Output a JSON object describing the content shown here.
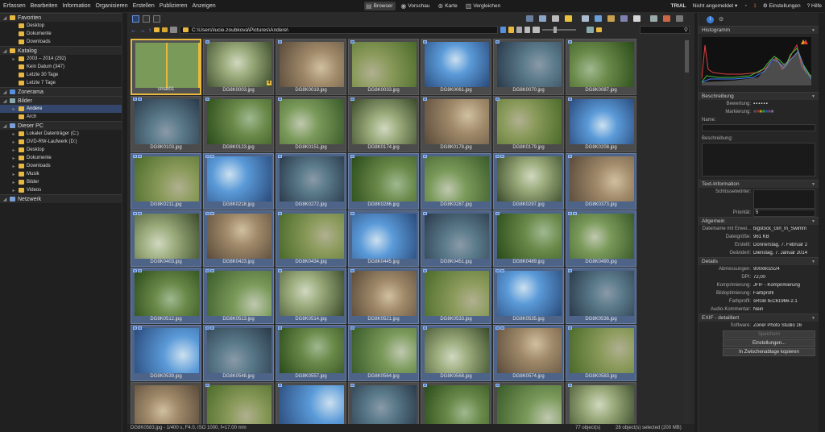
{
  "menu": [
    "Erfassen",
    "Bearbeiten",
    "Information",
    "Organisieren",
    "Erstellen",
    "Publizieren",
    "Anzeigen"
  ],
  "modes": [
    {
      "label": "Browser",
      "icon": "browser-icon"
    },
    {
      "label": "Vorschau",
      "icon": "preview-icon"
    },
    {
      "label": "Karte",
      "icon": "map-icon"
    },
    {
      "label": "Vergleichen",
      "icon": "compare-icon"
    }
  ],
  "rightmenu": {
    "trial": "TRIAL",
    "user": "Nicht angemeldet",
    "notif": "1",
    "settings": "Einstellungen",
    "help": "Hilfe"
  },
  "navigator": {
    "favoriten": {
      "title": "Favoriten",
      "items": [
        "Desktop",
        "Dokumente",
        "Downloads"
      ]
    },
    "katalog": {
      "title": "Katalog",
      "items": [
        "2003 – 2014 (292)",
        "Kein Datum (347)",
        "Letzte 30 Tage",
        "Letzte 7 Tage"
      ]
    },
    "zonerama": "Zonerama",
    "bilder": {
      "title": "Bilder",
      "items": [
        "Andere",
        "Arch"
      ]
    },
    "pc": {
      "title": "Dieser PC",
      "items": [
        "Lokaler Datenträger (C:)",
        "DVD-RW-Laufwerk (D:)",
        "Desktop",
        "Dokumente",
        "Downloads",
        "Musik",
        "Bilder",
        "Videos"
      ]
    },
    "netzwerk": "Netzwerk"
  },
  "path": "C:\\Users\\lucie.zoubkova\\Pictures\\Andere\\",
  "thumbs": [
    {
      "name": "small01",
      "sel": false,
      "first": true,
      "b": 0
    },
    {
      "name": "DG8K0003.jpg",
      "sel": false,
      "b": 1,
      "num": "4"
    },
    {
      "name": "DG8K0019.jpg",
      "sel": false,
      "b": 1
    },
    {
      "name": "DG8K0033.jpg",
      "sel": false,
      "b": 1
    },
    {
      "name": "DG8K0061.jpg",
      "sel": false,
      "b": 1
    },
    {
      "name": "DG8K0070.jpg",
      "sel": false,
      "b": 1
    },
    {
      "name": "DG8K0087.jpg",
      "sel": false,
      "b": 1
    },
    {
      "name": "DG8K0103.jpg",
      "sel": false,
      "b": 2
    },
    {
      "name": "DG8K0123.jpg",
      "sel": false,
      "b": 1
    },
    {
      "name": "DG8K0151.jpg",
      "sel": false,
      "b": 1
    },
    {
      "name": "DG8K0174.jpg",
      "sel": false,
      "b": 1
    },
    {
      "name": "DG8K0178.jpg",
      "sel": false,
      "b": 1
    },
    {
      "name": "DG8K0179.jpg",
      "sel": false,
      "b": 1
    },
    {
      "name": "DG8K0208.jpg",
      "sel": false,
      "b": 1
    },
    {
      "name": "DG8K0211.jpg",
      "sel": true,
      "b": 2
    },
    {
      "name": "DG8K0218.jpg",
      "sel": true,
      "b": 2
    },
    {
      "name": "DG8K0272.jpg",
      "sel": true,
      "b": 1
    },
    {
      "name": "DG8K0286.jpg",
      "sel": true,
      "b": 1
    },
    {
      "name": "DG8K0287.jpg",
      "sel": true,
      "b": 1
    },
    {
      "name": "DG8K0297.jpg",
      "sel": true,
      "b": 2
    },
    {
      "name": "DG8K0373.jpg",
      "sel": true,
      "b": 1
    },
    {
      "name": "DG8K0403.jpg",
      "sel": true,
      "b": 2
    },
    {
      "name": "DG8K0423.jpg",
      "sel": true,
      "b": 2
    },
    {
      "name": "DG8K0434.jpg",
      "sel": true,
      "b": 1
    },
    {
      "name": "DG8K0445.jpg",
      "sel": true,
      "b": 1
    },
    {
      "name": "DG8K0451.jpg",
      "sel": true,
      "b": 1
    },
    {
      "name": "DG8K0489.jpg",
      "sel": true,
      "b": 1
    },
    {
      "name": "DG8K0490.jpg",
      "sel": true,
      "b": 2
    },
    {
      "name": "DG8K0512.jpg",
      "sel": true,
      "b": 2
    },
    {
      "name": "DG8K0513.jpg",
      "sel": true,
      "b": 2
    },
    {
      "name": "DG8K0514.jpg",
      "sel": true,
      "b": 1
    },
    {
      "name": "DG8K0521.jpg",
      "sel": true,
      "b": 1
    },
    {
      "name": "DG8K0533.jpg",
      "sel": true,
      "b": 1
    },
    {
      "name": "DG8K0535.jpg",
      "sel": true,
      "b": 2
    },
    {
      "name": "DG8K0536.jpg",
      "sel": true,
      "b": 1
    },
    {
      "name": "DG8K0539.jpg",
      "sel": true,
      "b": 2
    },
    {
      "name": "DG8K0548.jpg",
      "sel": true,
      "b": 2
    },
    {
      "name": "DG8K0557.jpg",
      "sel": true,
      "b": 1
    },
    {
      "name": "DG8K0564.jpg",
      "sel": true,
      "b": 1
    },
    {
      "name": "DG8K0568.jpg",
      "sel": true,
      "b": 1
    },
    {
      "name": "DG8K0574.jpg",
      "sel": true,
      "b": 2
    },
    {
      "name": "DG8K0583.jpg",
      "sel": true,
      "b": 1
    },
    {
      "name": "",
      "sel": false,
      "b": 0
    },
    {
      "name": "",
      "sel": false,
      "b": 1
    },
    {
      "name": "",
      "sel": false,
      "b": 1
    },
    {
      "name": "",
      "sel": false,
      "b": 1
    },
    {
      "name": "",
      "sel": false,
      "b": 1
    },
    {
      "name": "",
      "sel": false,
      "b": 1
    },
    {
      "name": "",
      "sel": false,
      "b": 1
    }
  ],
  "status": {
    "left": "DG8K0583.jpg - 1/400 s, F4.0, ISO 1000, f=17.00 mm",
    "count": "77 object(s)",
    "selected": "28 object(s) selected (200 MB)"
  },
  "right": {
    "histogram": "Histogramm",
    "beschreibung": "Beschreibung",
    "bewertung": "Bewertung:",
    "markierung": "Markierung:",
    "name": "Name:",
    "beschreibung_l": "Beschreibung:",
    "text": "Text-Information",
    "schluessel": "Schlüsselwörter:",
    "prioritaet": "Priorität:",
    "prioritaet_v": "5",
    "allgemein": "Allgemein",
    "allg": [
      [
        "Dateiname mit Erwei...",
        "bigstock_Girl_In_Swimm"
      ],
      [
        "Dateigröße:",
        "961 KB"
      ],
      [
        "Erstellt:",
        "Donnerstag, 7. Februar 2"
      ],
      [
        "Geändert:",
        "Dienstag, 7. Januar 2014"
      ]
    ],
    "details": "Details",
    "det": [
      [
        "Abmessungen:",
        "900x602x24"
      ],
      [
        "DPI:",
        "72,00"
      ],
      [
        "Komprimierung:",
        "JFIF - Komprimierung"
      ],
      [
        "Bildoptimierung:",
        "Farbprofil"
      ],
      [
        "Farbprofil:",
        "sRGB IEC61966-2.1"
      ],
      [
        "Audio-Kommentar:",
        "Nein"
      ]
    ],
    "exif": "EXIF - detailliert",
    "exif_rows": [
      [
        "Software:",
        "Zoner Photo Studio 16"
      ]
    ],
    "btn_speichern": "Speichern",
    "btn_einst": "Einstellungen...",
    "btn_clip": "In Zwischenablage kopieren"
  }
}
